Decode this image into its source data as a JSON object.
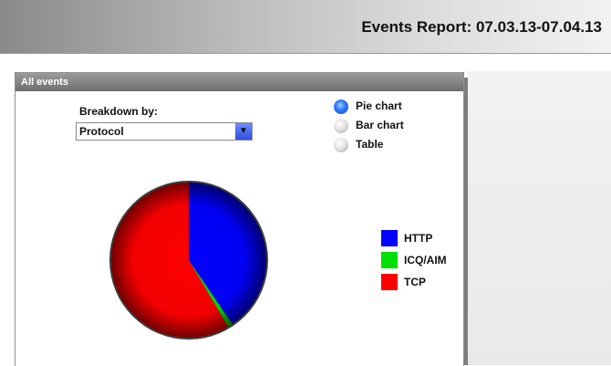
{
  "header": {
    "title": "Events Report: 07.03.13-07.04.13"
  },
  "panel": {
    "title": "All events",
    "breakdown_label": "Breakdown by:",
    "breakdown_value": "Protocol",
    "view_options": [
      {
        "label": "Pie chart",
        "selected": true
      },
      {
        "label": "Bar chart",
        "selected": false
      },
      {
        "label": "Table",
        "selected": false
      }
    ]
  },
  "icons": {
    "dropdown": "chevron-down-icon"
  },
  "chart_data": {
    "type": "pie",
    "categories": [
      "HTTP",
      "ICQ/AIM",
      "TCP"
    ],
    "values": [
      40.5,
      1.0,
      58.5
    ],
    "colors": [
      "#0000ff",
      "#00e000",
      "#ff0000"
    ],
    "legend": "right"
  }
}
